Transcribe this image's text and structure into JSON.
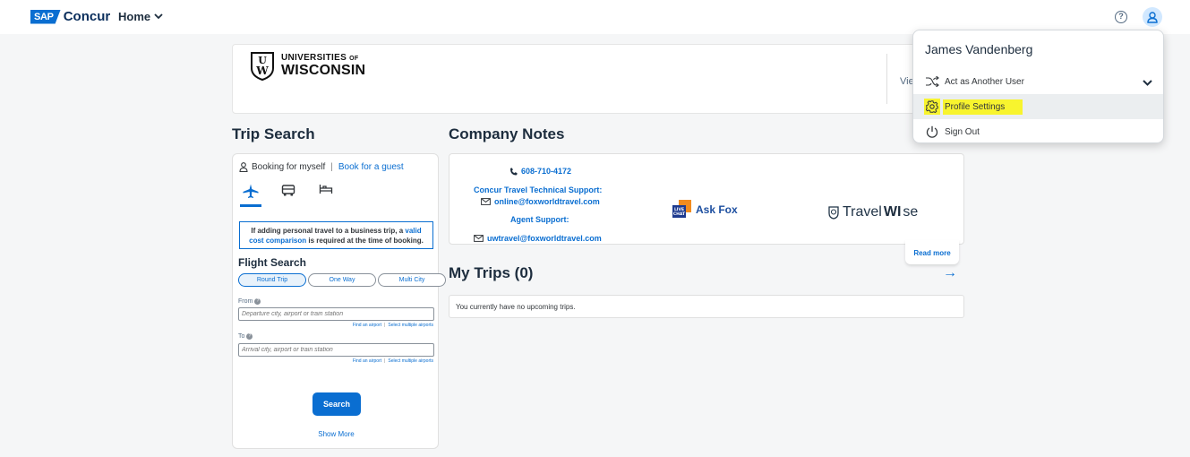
{
  "header": {
    "brand_badge": "SAP",
    "brand_name": "Concur",
    "home_label": "Home",
    "help_symbol": "?",
    "icons": [
      "chevron-down-icon",
      "help-icon",
      "user-icon"
    ]
  },
  "banner": {
    "org_line1": "UNIVERSITIES",
    "org_line1_suffix": "OF",
    "org_line2": "WISCONSIN",
    "crest_letters_top": "U",
    "crest_letters_bottom": "W",
    "view_text": "Vie"
  },
  "trip_search": {
    "title": "Trip Search",
    "booking_self": "Booking for myself",
    "separator": "|",
    "booking_guest": "Book for a guest",
    "modes": [
      "airplane-icon",
      "car-icon",
      "hotel-icon"
    ],
    "notice_part1": "If adding personal travel to a business trip, a ",
    "notice_link1": "valid",
    "notice_link2": "cost comparison",
    "notice_part2": " is required at the time of booking.",
    "flight_title": "Flight Search",
    "trip_types": [
      "Round Trip",
      "One Way",
      "Multi City"
    ],
    "from_label": "From",
    "from_placeholder": "Departure city, airport or train station",
    "to_label": "To",
    "to_placeholder": "Arrival city, airport or train station",
    "find_airport": "Find an airport",
    "select_multiple": "Select multiple airports",
    "search_label": "Search",
    "show_more": "Show More"
  },
  "company_notes": {
    "title": "Company Notes",
    "phone": "608-710-4172",
    "tech_support": "Concur Travel Technical Support:",
    "email1": "online@foxworldtravel.com",
    "agent_support": "Agent Support:",
    "email2": "uwtravel@foxworldtravel.com",
    "chat_badge_line1": "LIVE",
    "chat_badge_line2": "CHAT",
    "ask_fox": "Ask Fox",
    "travelwise_part1": "Travel",
    "travelwise_part2": "WI",
    "travelwise_part3": "se",
    "read_more": "Read more"
  },
  "my_trips": {
    "title": "My Trips (0)",
    "arrow": "→",
    "empty_message": "You currently have no upcoming trips."
  },
  "user_menu": {
    "name": "James Vandenberg",
    "items": [
      {
        "label": "Act as Another User",
        "icon": "shuffle-icon"
      },
      {
        "label": "Profile Settings",
        "icon": "gear-icon"
      },
      {
        "label": "Sign Out",
        "icon": "power-icon"
      }
    ]
  },
  "colors": {
    "accent": "#0a6ed1",
    "highlight": "#f8f42e",
    "background": "#f5f6f7"
  }
}
